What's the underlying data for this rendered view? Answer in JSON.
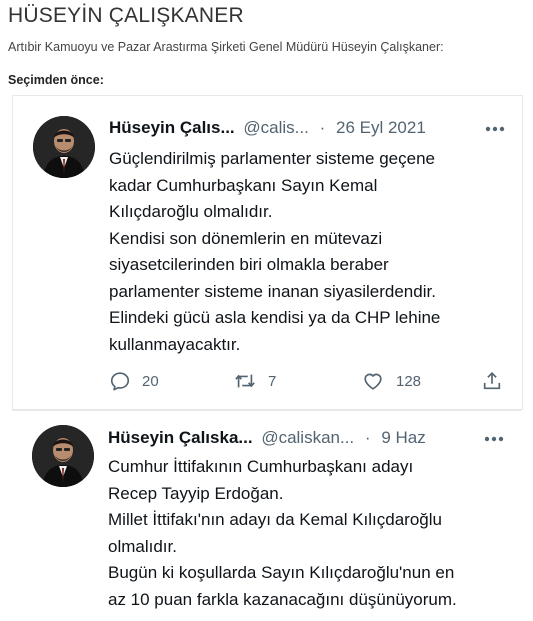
{
  "page": {
    "title": "HÜSEYİN ÇALIŞKANER",
    "subtitle": "Artıbir Kamuoyu ve Pazar Arastırma Şirketi Genel Müdürü Hüseyin Çalışkaner:",
    "section_label": "Seçimden önce:"
  },
  "tweets": [
    {
      "author_name": "Hüseyin Çalıs...",
      "handle": "@calis...",
      "separator": "·",
      "date": "26 Eyl 2021",
      "lines": [
        "Güçlendirilmiş parlamenter sisteme geçene",
        "kadar Cumhurbaşkanı Sayın Kemal",
        "Kılıçdaroğlu olmalıdır.",
        "Kendisi son dönemlerin en mütevazi",
        "siyasetcilerinden biri olmakla beraber",
        "parlamenter sisteme inanan siyasilerdendir.",
        "Elindeki gücü asla kendisi ya da CHP lehine",
        "kullanmayacaktır."
      ],
      "actions": {
        "replies": "20",
        "retweets": "7",
        "likes": "128"
      }
    },
    {
      "author_name": "Hüseyin Çalıska...",
      "handle": "@caliskan...",
      "separator": "·",
      "date": "9 Haz",
      "lines": [
        "Cumhur İttifakının Cumhurbaşkanı adayı",
        "Recep Tayyip Erdoğan.",
        "Millet İttifakı'nın adayı da Kemal Kılıçdaroğlu",
        "olmalıdır.",
        "Bugün ki koşullarda Sayın Kılıçdaroğlu'nun en",
        "az 10 puan farkla kazanacağını düşünüyorum."
      ]
    }
  ],
  "icons": {
    "more": "more-icon",
    "reply": "reply-icon",
    "retweet": "retweet-icon",
    "like": "heart-icon",
    "share": "share-icon"
  },
  "colors": {
    "text": "#0f1419",
    "muted": "#536471",
    "divider": "#e8e8e8"
  }
}
